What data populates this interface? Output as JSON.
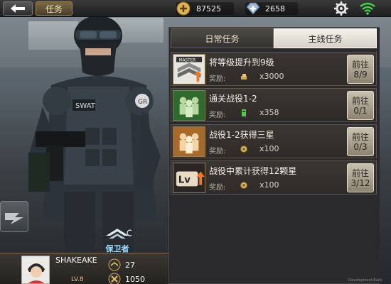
{
  "topbar": {
    "back_icon": "back-arrow-icon",
    "tab_label": "任务",
    "gold_value": "87525",
    "diamond_value": "2658",
    "gear_icon": "gear-icon",
    "wifi_icon": "wifi-icon"
  },
  "panel": {
    "tabs": [
      {
        "label": "日常任务",
        "active": false
      },
      {
        "label": "主线任务",
        "active": true
      }
    ],
    "tasks": [
      {
        "title": "将等级提升到9级",
        "reward_label": "奖励:",
        "reward_value": "x3000",
        "go_label": "前往",
        "progress": "8/9",
        "thumb": "master-rank-icon"
      },
      {
        "title": "通关战役1-2",
        "reward_label": "奖励:",
        "reward_value": "x358",
        "go_label": "前往",
        "progress": "0/1",
        "thumb": "squad-green-icon"
      },
      {
        "title": "战役1-2获得三星",
        "reward_label": "奖励:",
        "reward_value": "x100",
        "go_label": "前往",
        "progress": "0/3",
        "thumb": "squad-gold-icon"
      },
      {
        "title": "战役中累计获得12颗星",
        "reward_label": "奖励:",
        "reward_value": "x100",
        "go_label": "前往",
        "progress": "3/12",
        "thumb": "level-up-icon"
      }
    ]
  },
  "left": {
    "guard_label": "保卫者"
  },
  "profile": {
    "name": "SHAKEAKE",
    "level": "LV.8",
    "stat1": "27",
    "stat2": "1050"
  },
  "footer": {
    "dev_text": "Development Build"
  },
  "colors": {
    "panel_bg": "#2a2a2c",
    "go_btn": "#c9c0ae",
    "wifi": "#3fd24a"
  }
}
